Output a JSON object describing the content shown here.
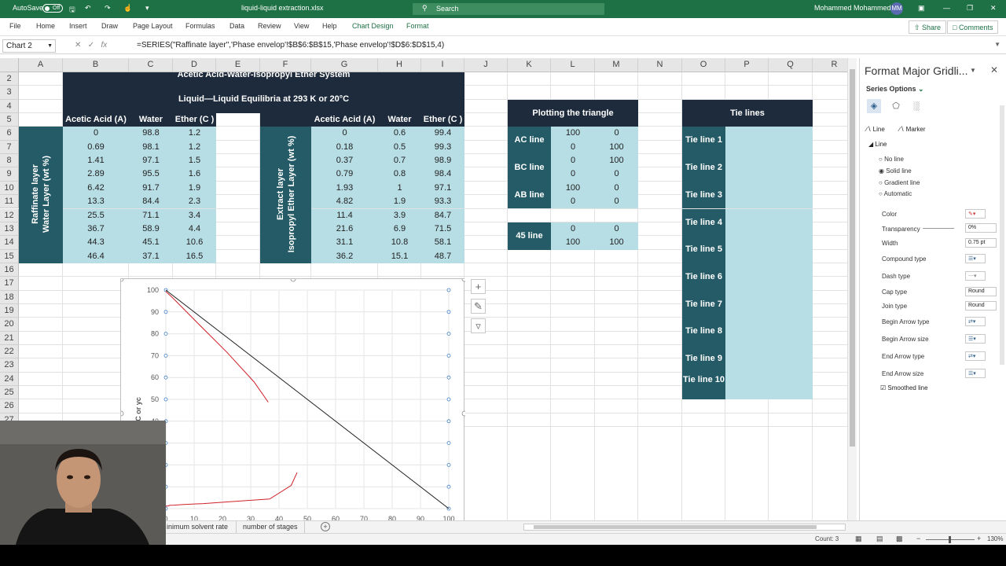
{
  "titlebar": {
    "autosave_label": "AutoSave",
    "autosave_state": "Off",
    "filename": "liquid-liquid extraction.xlsx",
    "search_placeholder": "Search",
    "user_name": "Mohammed Mohammed",
    "user_initials": "MM"
  },
  "ribbon": {
    "tabs": [
      "File",
      "Home",
      "Insert",
      "Draw",
      "Page Layout",
      "Formulas",
      "Data",
      "Review",
      "View",
      "Help",
      "Chart Design",
      "Format"
    ],
    "share": "Share",
    "comments": "Comments"
  },
  "formula_bar": {
    "name_box": "Chart 2",
    "formula": "=SERIES(\"Raffinate layer\",'Phase envelop'!$B$6:$B$15,'Phase envelop'!$D$6:$D$15,4)"
  },
  "columns": [
    "A",
    "B",
    "C",
    "D",
    "E",
    "F",
    "G",
    "H",
    "I",
    "J",
    "K",
    "L",
    "M",
    "N",
    "O",
    "P",
    "Q",
    "R"
  ],
  "rows": [
    "2",
    "3",
    "4",
    "5",
    "6",
    "7",
    "8",
    "9",
    "10",
    "11",
    "12",
    "13",
    "14",
    "15",
    "16",
    "17",
    "18",
    "19",
    "20",
    "21",
    "22",
    "23",
    "24",
    "25",
    "26",
    "27"
  ],
  "sheet": {
    "title1": "Acetic Acid-Water-Isopropyl Ether System",
    "title2": "Liquid—Liquid Equilibria at 293 K or 20°C",
    "headers": [
      "Acetic Acid (A)",
      "Water",
      "Ether (C )"
    ],
    "raffinate_label": "Raffinate layer",
    "raffinate_sublabel": "Water Layer (wt %)",
    "extract_label": "Extract layer",
    "extract_sublabel": "Isopropyl Ether Layer (wt %)",
    "raffinate": [
      [
        "0",
        "98.8",
        "1.2"
      ],
      [
        "0.69",
        "98.1",
        "1.2"
      ],
      [
        "1.41",
        "97.1",
        "1.5"
      ],
      [
        "2.89",
        "95.5",
        "1.6"
      ],
      [
        "6.42",
        "91.7",
        "1.9"
      ],
      [
        "13.3",
        "84.4",
        "2.3"
      ],
      [
        "25.5",
        "71.1",
        "3.4"
      ],
      [
        "36.7",
        "58.9",
        "4.4"
      ],
      [
        "44.3",
        "45.1",
        "10.6"
      ],
      [
        "46.4",
        "37.1",
        "16.5"
      ]
    ],
    "extract": [
      [
        "0",
        "0.6",
        "99.4"
      ],
      [
        "0.18",
        "0.5",
        "99.3"
      ],
      [
        "0.37",
        "0.7",
        "98.9"
      ],
      [
        "0.79",
        "0.8",
        "98.4"
      ],
      [
        "1.93",
        "1",
        "97.1"
      ],
      [
        "4.82",
        "1.9",
        "93.3"
      ],
      [
        "11.4",
        "3.9",
        "84.7"
      ],
      [
        "21.6",
        "6.9",
        "71.5"
      ],
      [
        "31.1",
        "10.8",
        "58.1"
      ],
      [
        "36.2",
        "15.1",
        "48.7"
      ]
    ],
    "triangle_title": "Plotting the triangle",
    "triangle": [
      {
        "label": "AC line",
        "rows": [
          [
            "100",
            "0"
          ],
          [
            "0",
            "100"
          ]
        ]
      },
      {
        "label": "BC line",
        "rows": [
          [
            "0",
            "100"
          ],
          [
            "0",
            "0"
          ]
        ]
      },
      {
        "label": "AB line",
        "rows": [
          [
            "100",
            "0"
          ],
          [
            "0",
            "0"
          ]
        ]
      }
    ],
    "line45": {
      "label": "45 line",
      "rows": [
        [
          "0",
          "0"
        ],
        [
          "100",
          "100"
        ]
      ]
    },
    "tie_title": "Tie lines",
    "tie_lines": [
      "Tie line 1",
      "Tie line 2",
      "Tie line 3",
      "Tie line 4",
      "Tie line 5",
      "Tie line 6",
      "Tie line 7",
      "Tie line 8",
      "Tie line 9",
      "Tie line 10"
    ]
  },
  "chart_data": {
    "type": "scatter",
    "ylabel": "xC or yc",
    "xticks": [
      "0",
      "10",
      "20",
      "30",
      "40",
      "50",
      "60",
      "70",
      "80",
      "90",
      "100"
    ],
    "yticks": [
      "100",
      "90",
      "80",
      "70",
      "60",
      "50",
      "40"
    ],
    "xlim": [
      0,
      100
    ],
    "ylim": [
      0,
      100
    ],
    "series": [
      {
        "name": "AC line",
        "color": "#222222",
        "x": [
          100,
          0
        ],
        "y": [
          0,
          100
        ]
      },
      {
        "name": "Raffinate layer",
        "color": "#d0202a",
        "x": [
          0,
          0.69,
          1.41,
          2.89,
          6.42,
          13.3,
          25.5,
          36.7,
          44.3,
          46.4
        ],
        "y": [
          1.2,
          1.2,
          1.5,
          1.6,
          1.9,
          2.3,
          3.4,
          4.4,
          10.6,
          16.5
        ]
      },
      {
        "name": "Extract layer",
        "color": "#d0202a",
        "x": [
          0,
          0.18,
          0.37,
          0.79,
          1.93,
          4.82,
          11.4,
          21.6,
          31.1,
          36.2
        ],
        "y": [
          99.4,
          99.3,
          98.9,
          98.4,
          97.1,
          93.3,
          84.7,
          71.5,
          58.1,
          48.7
        ]
      }
    ]
  },
  "format_panel": {
    "title": "Format Major Gridli...",
    "series_options": "Series Options",
    "tab_line": "Line",
    "tab_marker": "Marker",
    "section_line": "Line",
    "radio": [
      "No line",
      "Solid line",
      "Gradient line",
      "Automatic"
    ],
    "props": [
      "Color",
      "Transparency",
      "Width",
      "Compound type",
      "Dash type",
      "Cap type",
      "Join type",
      "Begin Arrow type",
      "Begin Arrow size",
      "End Arrow type",
      "End Arrow size"
    ],
    "transparency": "0%",
    "width": "0.75 pt",
    "cap_type": "Round",
    "join_type": "Round",
    "smoothed": "Smoothed line"
  },
  "sheet_tabs": [
    "inimum solvent rate",
    "number of stages"
  ],
  "status": {
    "count": "Count: 3",
    "zoom": "130%"
  }
}
